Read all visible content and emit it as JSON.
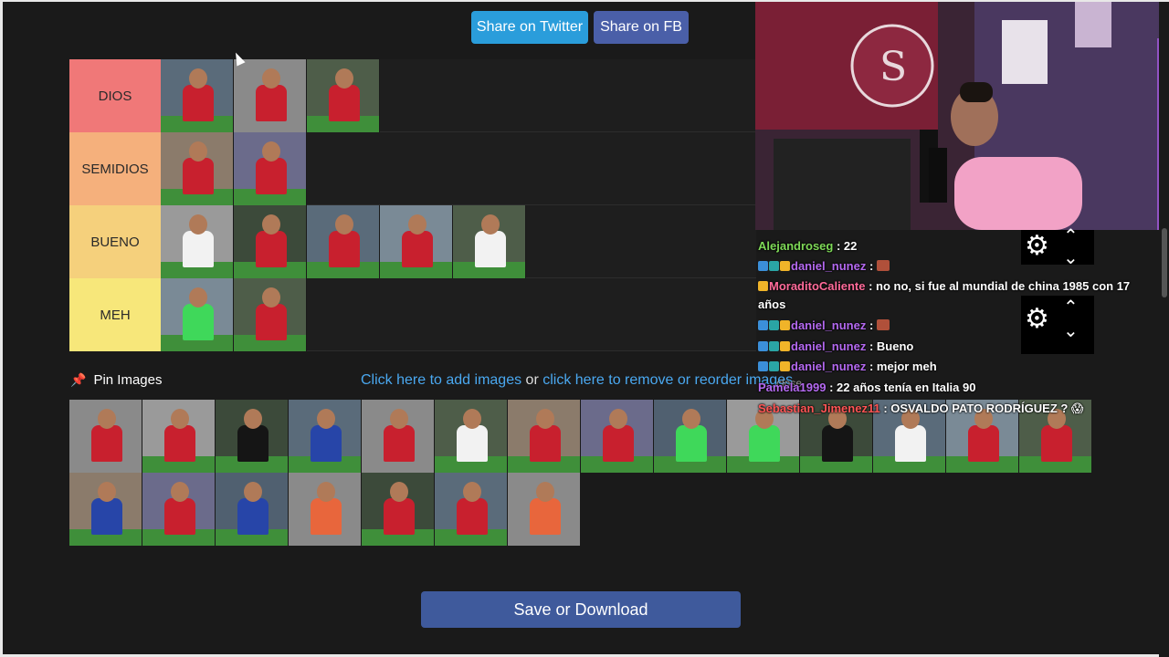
{
  "header": {
    "share_twitter": "Share on Twitter",
    "share_fb": "Share on FB"
  },
  "tiers": [
    {
      "label": "DIOS",
      "color": "#f07878",
      "items": [
        "jersey-red-celebrate",
        "jersey-red-portrait",
        "jersey-red-10"
      ]
    },
    {
      "label": "SEMIDIOS",
      "color": "#f5b07c",
      "items": [
        "jersey-red-running",
        "jersey-red-salute"
      ]
    },
    {
      "label": "BUENO",
      "color": "#f5d07c",
      "items": [
        "jersey-white-8",
        "jersey-red-11",
        "jersey-red-joma",
        "jersey-red-grass",
        "jersey-white-4"
      ]
    },
    {
      "label": "MEH",
      "color": "#f7e77a",
      "items": [
        "goalkeeper-green",
        "jersey-red-3"
      ]
    }
  ],
  "pin": {
    "label": "Pin Images"
  },
  "links": {
    "add": "Click here to add images",
    "or": " or ",
    "remove": "click here to remove or reorder images",
    "close": "close"
  },
  "pool_count_note": "",
  "save": {
    "label": "Save or Download"
  },
  "chat": [
    {
      "user": "Alejandroseg",
      "user_color": "#7ed957",
      "text": "22",
      "badges": []
    },
    {
      "user": "daniel_nunez",
      "user_color": "#b469f0",
      "text": "",
      "badges": [
        "#3b8fd9",
        "#2aa5a5",
        "#f0b429"
      ],
      "emote": true
    },
    {
      "user": "MoraditoCaliente",
      "user_color": "#ff6b9a",
      "text": "no no, si fue al mundial de china 1985 con 17",
      "badges": [
        "#f0b429"
      ]
    },
    {
      "user": "",
      "user_color": "#fff",
      "text": "años",
      "badges": []
    },
    {
      "user": "daniel_nunez",
      "user_color": "#b469f0",
      "text": "",
      "badges": [
        "#3b8fd9",
        "#2aa5a5",
        "#f0b429"
      ],
      "emote": true
    },
    {
      "user": "daniel_nunez",
      "user_color": "#b469f0",
      "text": "Bueno",
      "badges": [
        "#3b8fd9",
        "#2aa5a5",
        "#f0b429"
      ]
    },
    {
      "user": "daniel_nunez",
      "user_color": "#b469f0",
      "text": "mejor meh",
      "badges": [
        "#3b8fd9",
        "#2aa5a5",
        "#f0b429"
      ]
    },
    {
      "user": "Pamela1999",
      "user_color": "#b469f0",
      "text": "22 años tenía en Italia 90",
      "badges": []
    },
    {
      "user": "Sebastian_Jimenez11",
      "user_color": "#ff5555",
      "text": "OSVALDO PATO RODRÍGUEZ ? 😱",
      "badges": []
    }
  ]
}
